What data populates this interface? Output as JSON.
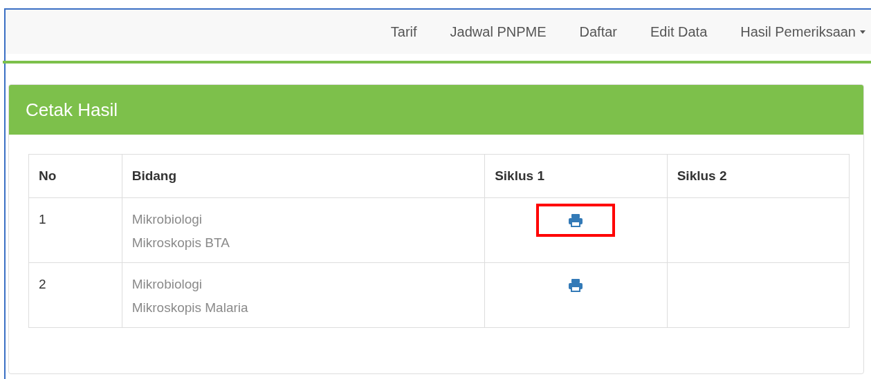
{
  "navbar": {
    "items": [
      {
        "label": "Tarif",
        "dropdown": false
      },
      {
        "label": "Jadwal PNPME",
        "dropdown": false
      },
      {
        "label": "Daftar",
        "dropdown": false
      },
      {
        "label": "Edit Data",
        "dropdown": false
      },
      {
        "label": "Hasil Pemeriksaan",
        "dropdown": true
      }
    ]
  },
  "panel": {
    "title": "Cetak Hasil"
  },
  "table": {
    "columns": [
      "No",
      "Bidang",
      "Siklus 1",
      "Siklus 2"
    ],
    "rows": [
      {
        "no": "1",
        "bidang": [
          "Mikrobiologi",
          "Mikroskopis BTA"
        ],
        "siklus_1": {
          "print": true,
          "highlighted": true
        }
      },
      {
        "no": "2",
        "bidang": [
          "Mikrobiologi",
          "Mikroskopis Malaria"
        ],
        "siklus_1": {
          "print": true,
          "highlighted": false
        }
      }
    ]
  }
}
